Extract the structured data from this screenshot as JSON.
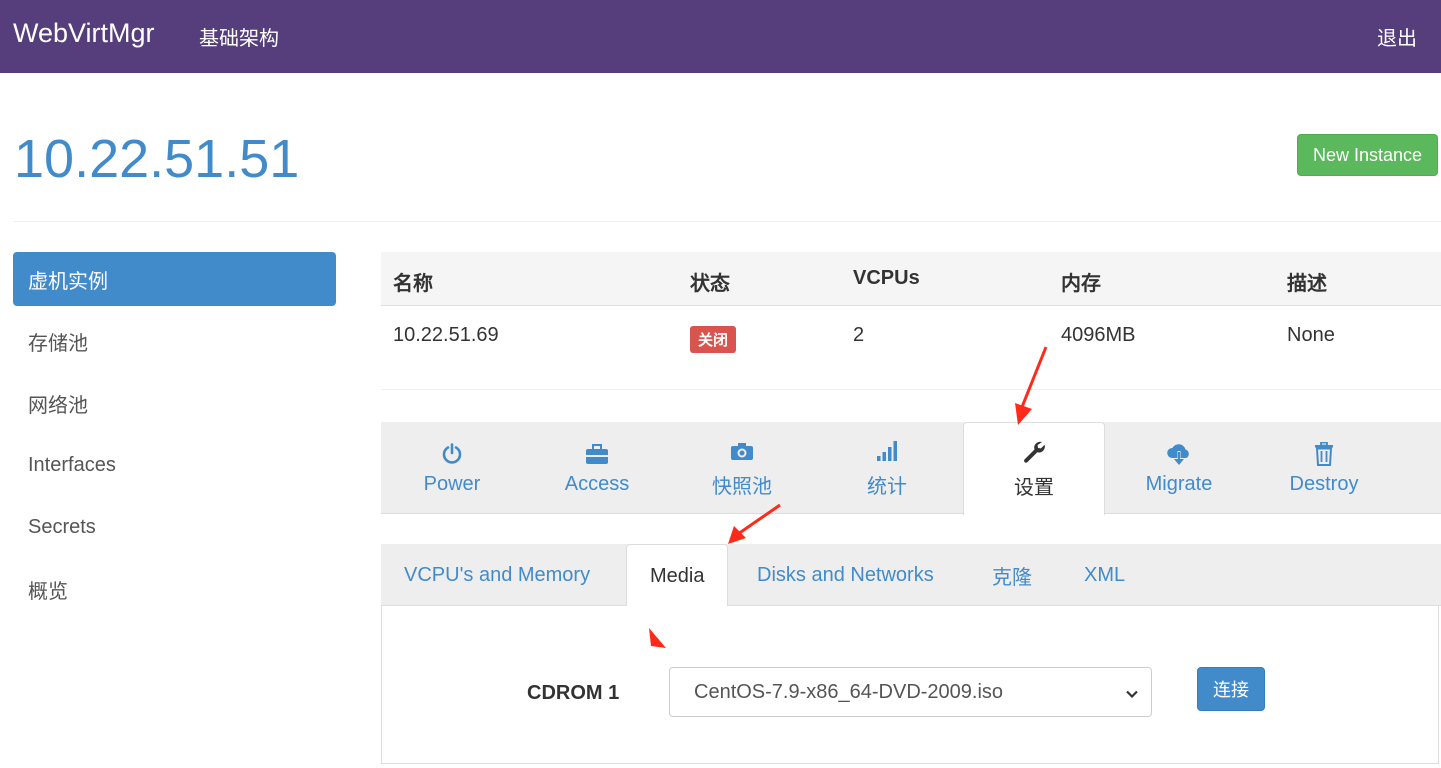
{
  "navbar": {
    "brand": "WebVirtMgr",
    "link": "基础架构",
    "logout": "退出"
  },
  "header": {
    "title": "10.22.51.51",
    "new_instance": "New Instance"
  },
  "sidebar": {
    "items": [
      {
        "label": "虚机实例",
        "active": true
      },
      {
        "label": "存储池"
      },
      {
        "label": "网络池"
      },
      {
        "label": "Interfaces"
      },
      {
        "label": "Secrets"
      },
      {
        "label": "概览"
      }
    ]
  },
  "instance_table": {
    "headers": [
      "名称",
      "状态",
      "VCPUs",
      "内存",
      "描述"
    ],
    "row": {
      "name": "10.22.51.69",
      "status": "关闭",
      "vcpus": "2",
      "memory": "4096MB",
      "description": "None"
    }
  },
  "action_tabs": [
    {
      "label": "Power",
      "icon": "power-icon"
    },
    {
      "label": "Access",
      "icon": "briefcase-icon"
    },
    {
      "label": "快照池",
      "icon": "camera-icon"
    },
    {
      "label": "统计",
      "icon": "signal-icon"
    },
    {
      "label": "设置",
      "icon": "wrench-icon",
      "active": true
    },
    {
      "label": "Migrate",
      "icon": "cloud-download-icon"
    },
    {
      "label": "Destroy",
      "icon": "trash-icon"
    }
  ],
  "sub_tabs": [
    {
      "label": "VCPU's and Memory"
    },
    {
      "label": "Media",
      "active": true
    },
    {
      "label": "Disks and Networks"
    },
    {
      "label": "克隆"
    },
    {
      "label": "XML"
    }
  ],
  "media": {
    "cdrom_label": "CDROM 1",
    "selected_iso": "CentOS-7.9-x86_64-DVD-2009.iso",
    "connect_label": "连接"
  },
  "colors": {
    "navbar": "#563d7c",
    "primary": "#428bca",
    "success": "#5cb85c",
    "danger": "#d9534f",
    "annotation_arrow": "#ff2a1a"
  }
}
